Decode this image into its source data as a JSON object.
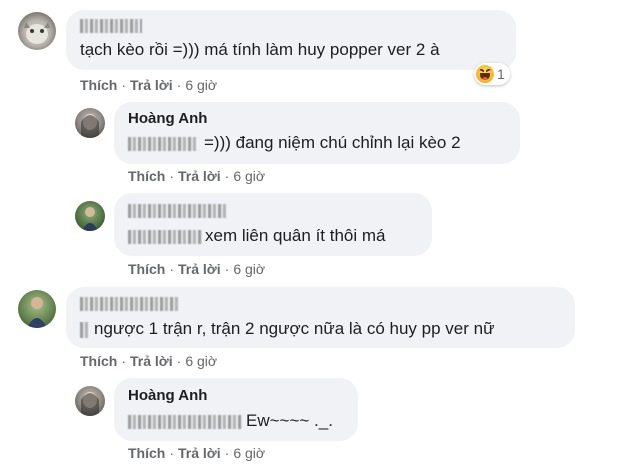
{
  "comments": [
    {
      "text": "tạch kèo rồi =))) má tính làm huy popper ver 2 à",
      "actions": {
        "like": "Thích",
        "reply": "Trả lời",
        "time": "6 giờ"
      },
      "reaction": {
        "icon": "haha-reaction-icon",
        "count": "1"
      }
    },
    {
      "name": "Hoàng Anh",
      "text": "=))) đang niệm chú chỉnh lại kèo 2",
      "actions": {
        "like": "Thích",
        "reply": "Trả lời",
        "time": "6 giờ"
      }
    },
    {
      "text": "xem liên quân ít thôi má",
      "actions": {
        "like": "Thích",
        "reply": "Trả lời",
        "time": "6 giờ"
      }
    },
    {
      "text": "ngược 1 trận r, trận 2 ngược nữa là có huy pp ver nữ",
      "actions": {
        "like": "Thích",
        "reply": "Trả lời",
        "time": "6 giờ"
      }
    },
    {
      "name": "Hoàng Anh",
      "text": "Ew~~~~ ._.",
      "actions": {
        "like": "Thích",
        "reply": "Trả lời",
        "time": "6 giờ"
      }
    }
  ],
  "separator": "·",
  "colors": {
    "bubble": "#f0f2f5",
    "meta": "#65676b",
    "text": "#1c1e21"
  }
}
